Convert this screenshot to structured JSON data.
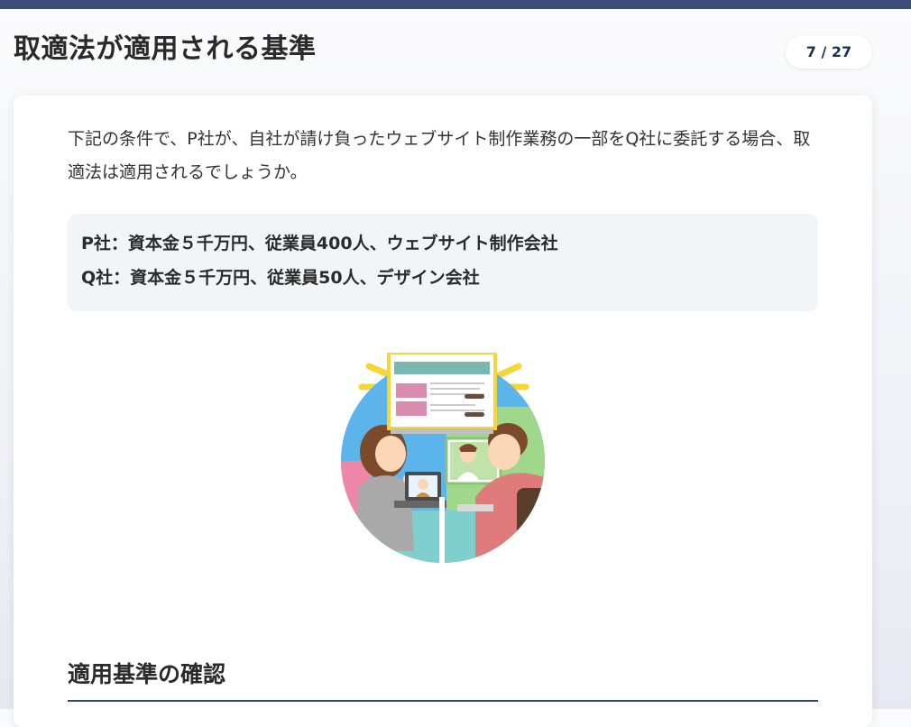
{
  "header": {
    "title": "取適法が適用される基準",
    "counter": "7 / 27"
  },
  "question": {
    "text": "下記の条件で、P社が、自社が請け負ったウェブサイト制作業務の一部をQ社に委託する場合、取適法は適用されるでしょうか。"
  },
  "conditions": [
    "P社：資本金５千万円、従業員400人、ウェブサイト制作会社",
    "Q社：資本金５千万円、従業員50人、デザイン会社"
  ],
  "section": {
    "heading": "適用基準の確認"
  },
  "colors": {
    "top_bar": "#3a4f77",
    "accent_navy": "#2f4470",
    "condition_bg": "#f2f5f8"
  }
}
